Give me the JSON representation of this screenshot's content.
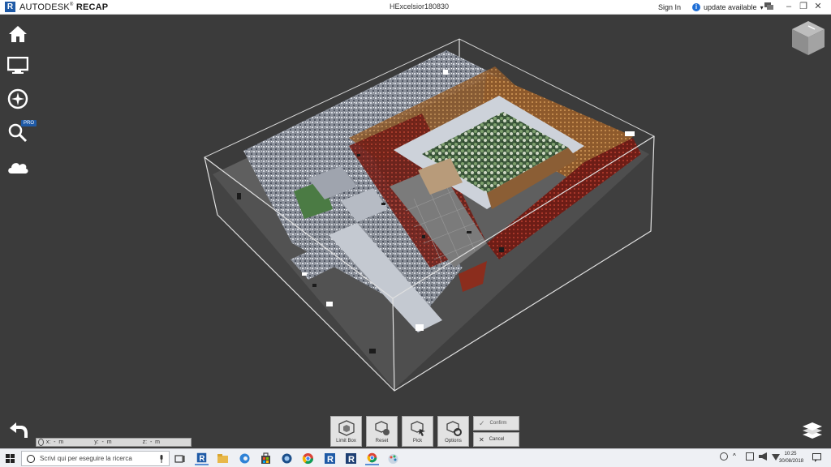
{
  "titlebar": {
    "logo_letter": "R",
    "brand_light": "AUTODESK",
    "brand_bold": "RECAP",
    "document": "HExcelsior180830",
    "sign_in": "Sign In",
    "update": "update available",
    "update_info_glyph": "i"
  },
  "sidebar": {
    "items": [
      {
        "icon": "home-icon"
      },
      {
        "icon": "monitor-icon"
      },
      {
        "icon": "compass-icon"
      },
      {
        "icon": "search-icon",
        "badge": "PRO"
      },
      {
        "icon": "cloud-icon"
      }
    ]
  },
  "coords": {
    "x": "x:  -  m",
    "y": "y:  -  m",
    "z": "z:  -  m"
  },
  "tools": {
    "limit_box": "Limit Box",
    "reset": "Reset",
    "pick": "Pick",
    "options": "Options",
    "confirm": "Confirm",
    "cancel": "Cancel"
  },
  "taskbar": {
    "search_placeholder": "Scrivi qui per eseguire la ricerca",
    "time": "10:25",
    "date": "30/08/2018"
  },
  "colors": {
    "viewport_bg": "#3b3b3b",
    "accent": "#1f5aa6",
    "floor": "#5b5b5b",
    "box_line": "#d9d9d9"
  }
}
